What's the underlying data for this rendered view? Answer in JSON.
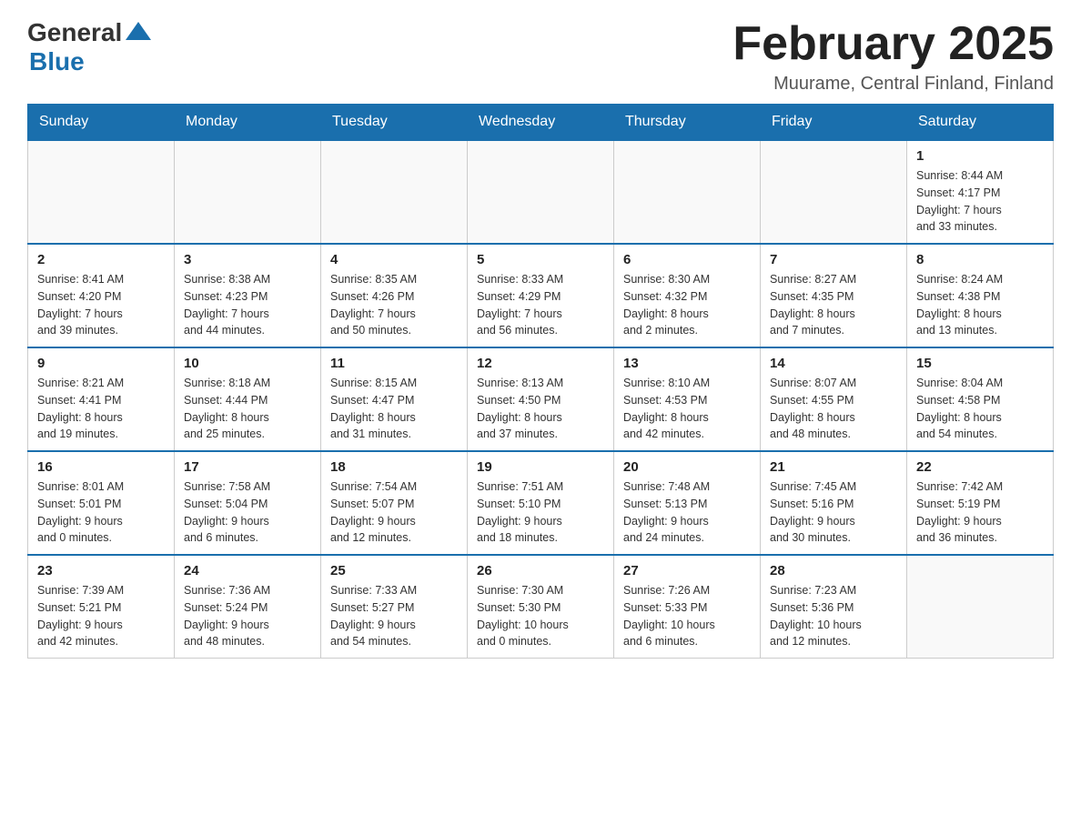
{
  "logo": {
    "general": "General",
    "blue": "Blue"
  },
  "header": {
    "title": "February 2025",
    "location": "Muurame, Central Finland, Finland"
  },
  "days_of_week": [
    "Sunday",
    "Monday",
    "Tuesday",
    "Wednesday",
    "Thursday",
    "Friday",
    "Saturday"
  ],
  "weeks": [
    [
      {
        "day": "",
        "info": ""
      },
      {
        "day": "",
        "info": ""
      },
      {
        "day": "",
        "info": ""
      },
      {
        "day": "",
        "info": ""
      },
      {
        "day": "",
        "info": ""
      },
      {
        "day": "",
        "info": ""
      },
      {
        "day": "1",
        "info": "Sunrise: 8:44 AM\nSunset: 4:17 PM\nDaylight: 7 hours\nand 33 minutes."
      }
    ],
    [
      {
        "day": "2",
        "info": "Sunrise: 8:41 AM\nSunset: 4:20 PM\nDaylight: 7 hours\nand 39 minutes."
      },
      {
        "day": "3",
        "info": "Sunrise: 8:38 AM\nSunset: 4:23 PM\nDaylight: 7 hours\nand 44 minutes."
      },
      {
        "day": "4",
        "info": "Sunrise: 8:35 AM\nSunset: 4:26 PM\nDaylight: 7 hours\nand 50 minutes."
      },
      {
        "day": "5",
        "info": "Sunrise: 8:33 AM\nSunset: 4:29 PM\nDaylight: 7 hours\nand 56 minutes."
      },
      {
        "day": "6",
        "info": "Sunrise: 8:30 AM\nSunset: 4:32 PM\nDaylight: 8 hours\nand 2 minutes."
      },
      {
        "day": "7",
        "info": "Sunrise: 8:27 AM\nSunset: 4:35 PM\nDaylight: 8 hours\nand 7 minutes."
      },
      {
        "day": "8",
        "info": "Sunrise: 8:24 AM\nSunset: 4:38 PM\nDaylight: 8 hours\nand 13 minutes."
      }
    ],
    [
      {
        "day": "9",
        "info": "Sunrise: 8:21 AM\nSunset: 4:41 PM\nDaylight: 8 hours\nand 19 minutes."
      },
      {
        "day": "10",
        "info": "Sunrise: 8:18 AM\nSunset: 4:44 PM\nDaylight: 8 hours\nand 25 minutes."
      },
      {
        "day": "11",
        "info": "Sunrise: 8:15 AM\nSunset: 4:47 PM\nDaylight: 8 hours\nand 31 minutes."
      },
      {
        "day": "12",
        "info": "Sunrise: 8:13 AM\nSunset: 4:50 PM\nDaylight: 8 hours\nand 37 minutes."
      },
      {
        "day": "13",
        "info": "Sunrise: 8:10 AM\nSunset: 4:53 PM\nDaylight: 8 hours\nand 42 minutes."
      },
      {
        "day": "14",
        "info": "Sunrise: 8:07 AM\nSunset: 4:55 PM\nDaylight: 8 hours\nand 48 minutes."
      },
      {
        "day": "15",
        "info": "Sunrise: 8:04 AM\nSunset: 4:58 PM\nDaylight: 8 hours\nand 54 minutes."
      }
    ],
    [
      {
        "day": "16",
        "info": "Sunrise: 8:01 AM\nSunset: 5:01 PM\nDaylight: 9 hours\nand 0 minutes."
      },
      {
        "day": "17",
        "info": "Sunrise: 7:58 AM\nSunset: 5:04 PM\nDaylight: 9 hours\nand 6 minutes."
      },
      {
        "day": "18",
        "info": "Sunrise: 7:54 AM\nSunset: 5:07 PM\nDaylight: 9 hours\nand 12 minutes."
      },
      {
        "day": "19",
        "info": "Sunrise: 7:51 AM\nSunset: 5:10 PM\nDaylight: 9 hours\nand 18 minutes."
      },
      {
        "day": "20",
        "info": "Sunrise: 7:48 AM\nSunset: 5:13 PM\nDaylight: 9 hours\nand 24 minutes."
      },
      {
        "day": "21",
        "info": "Sunrise: 7:45 AM\nSunset: 5:16 PM\nDaylight: 9 hours\nand 30 minutes."
      },
      {
        "day": "22",
        "info": "Sunrise: 7:42 AM\nSunset: 5:19 PM\nDaylight: 9 hours\nand 36 minutes."
      }
    ],
    [
      {
        "day": "23",
        "info": "Sunrise: 7:39 AM\nSunset: 5:21 PM\nDaylight: 9 hours\nand 42 minutes."
      },
      {
        "day": "24",
        "info": "Sunrise: 7:36 AM\nSunset: 5:24 PM\nDaylight: 9 hours\nand 48 minutes."
      },
      {
        "day": "25",
        "info": "Sunrise: 7:33 AM\nSunset: 5:27 PM\nDaylight: 9 hours\nand 54 minutes."
      },
      {
        "day": "26",
        "info": "Sunrise: 7:30 AM\nSunset: 5:30 PM\nDaylight: 10 hours\nand 0 minutes."
      },
      {
        "day": "27",
        "info": "Sunrise: 7:26 AM\nSunset: 5:33 PM\nDaylight: 10 hours\nand 6 minutes."
      },
      {
        "day": "28",
        "info": "Sunrise: 7:23 AM\nSunset: 5:36 PM\nDaylight: 10 hours\nand 12 minutes."
      },
      {
        "day": "",
        "info": ""
      }
    ]
  ]
}
